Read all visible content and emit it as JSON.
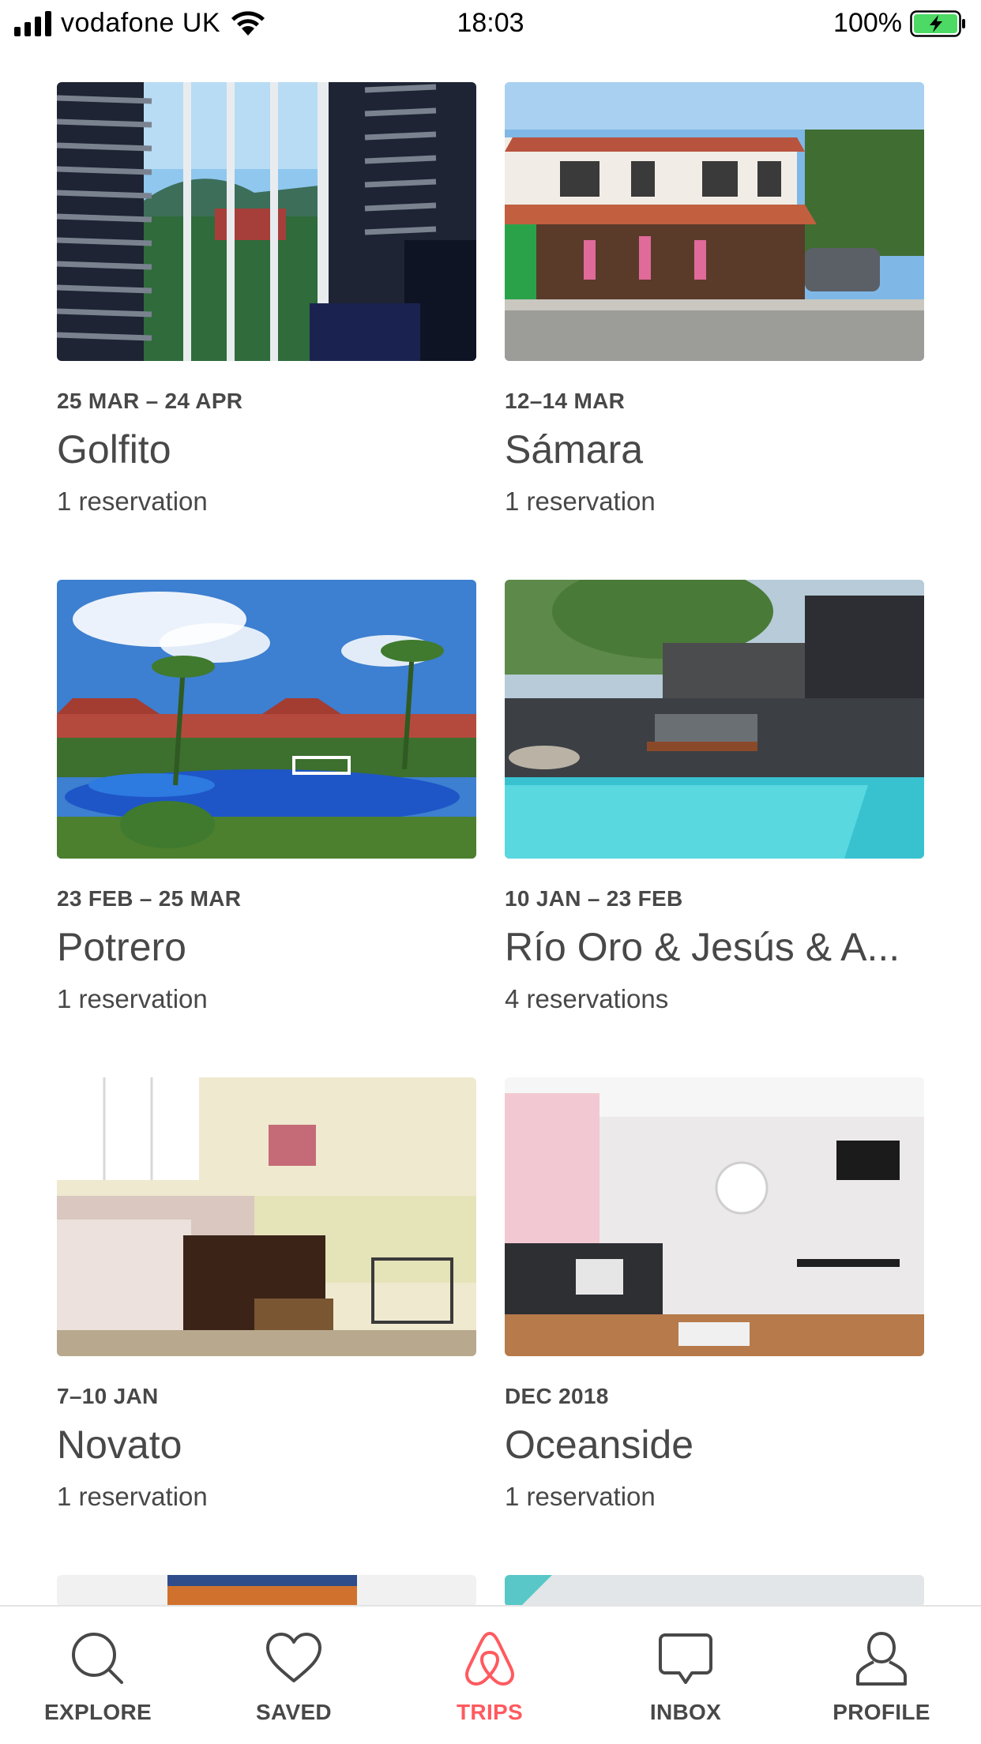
{
  "status_bar": {
    "carrier": "vodafone UK",
    "time": "18:03",
    "battery": "100%"
  },
  "trips": [
    {
      "dates": "25 MAR – 24 APR",
      "name": "Golfito",
      "reservations": "1 reservation"
    },
    {
      "dates": "12–14 MAR",
      "name": "Sámara",
      "reservations": "1 reservation"
    },
    {
      "dates": "23 FEB – 25 MAR",
      "name": "Potrero",
      "reservations": "1 reservation"
    },
    {
      "dates": "10 JAN – 23 FEB",
      "name": "Río Oro & Jesús & A...",
      "reservations": "4 reservations"
    },
    {
      "dates": "7–10 JAN",
      "name": "Novato",
      "reservations": "1 reservation"
    },
    {
      "dates": "DEC 2018",
      "name": "Oceanside",
      "reservations": "1 reservation"
    }
  ],
  "tabs": [
    {
      "label": "EXPLORE",
      "icon": "search-icon"
    },
    {
      "label": "SAVED",
      "icon": "heart-icon"
    },
    {
      "label": "TRIPS",
      "icon": "airbnb-logo-icon",
      "active": true
    },
    {
      "label": "INBOX",
      "icon": "message-icon"
    },
    {
      "label": "PROFILE",
      "icon": "user-icon"
    }
  ],
  "colors": {
    "accent": "#ff5a5f",
    "text": "#484848"
  }
}
